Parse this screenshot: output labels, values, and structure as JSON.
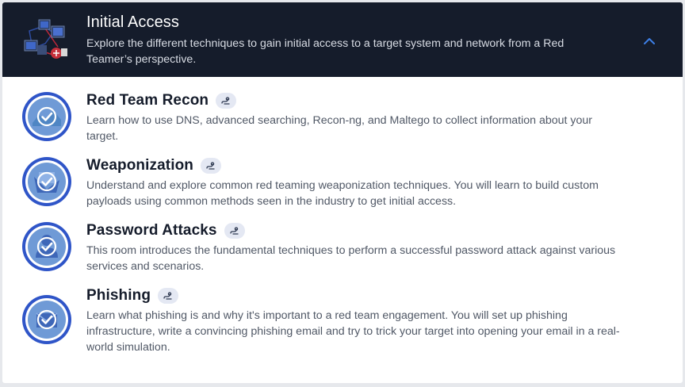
{
  "module": {
    "title": "Initial Access",
    "description": "Explore the different techniques to gain initial access to a target system and network from a Red Teamer’s perspective.",
    "expanded": true
  },
  "rooms": [
    {
      "title": "Red Team Recon",
      "description": "Learn how to use DNS, advanced searching, Recon-ng, and Maltego to collect information about your target.",
      "completed": true
    },
    {
      "title": "Weaponization",
      "description": "Understand and explore common red teaming weaponization techniques. You will learn to build custom payloads using common methods seen in the industry to get initial access.",
      "completed": true
    },
    {
      "title": "Password Attacks",
      "description": "This room introduces the fundamental techniques to perform a successful password attack against various services and scenarios.",
      "completed": true
    },
    {
      "title": "Phishing",
      "description": "Learn what phishing is and why it's important to a red team engagement. You will set up phishing infrastructure, write a convincing phishing email and try to trick your target into opening your email in a real-world simulation.",
      "completed": true
    }
  ],
  "colors": {
    "header_bg": "#151c2b",
    "accent_blue": "#2f55c8",
    "check_blue": "#5b8fe0",
    "badge_bg": "#e4e8f3"
  },
  "icons": {
    "collapse": "chevron-up-icon",
    "room_badge": "path-icon",
    "completed": "check-circle-icon"
  }
}
